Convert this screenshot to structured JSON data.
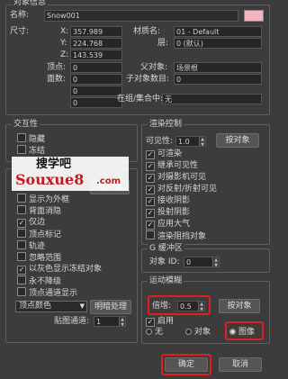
{
  "general": {
    "group_title": "对象信息",
    "name_label": "名称:",
    "name_value": "Snow001",
    "dims_label": "尺寸:",
    "x_label": "X:",
    "x_value": "357.989",
    "y_label": "Y:",
    "y_value": "224.768",
    "z_label": "Z:",
    "z_value": "143.539",
    "verts_label": "顶点:",
    "verts_value": "0",
    "faces_label": "面数:",
    "faces_value": "0",
    "f3_value": "0",
    "f4_value": "0",
    "material_label": "材质名:",
    "material_value": "01 - Default",
    "layer_label": "层:",
    "layer_value": "0 (默认)",
    "parent_label": "父对象:",
    "parent_value": "场景根",
    "children_label": "子对象数目:",
    "children_value": "0",
    "group_label": "在组/集合中:",
    "group_value": "无",
    "swatch_color": "#f2b6c0"
  },
  "interactivity": {
    "title": "交互性",
    "hide": "隐藏",
    "freeze": "冻结"
  },
  "display": {
    "by_object": "按对象",
    "display_as_box": "显示为外框",
    "backface_cull": "背面消隐",
    "edges_only": "仅边",
    "vertex_ticks": "顶点标记",
    "trajectory": "轨迹",
    "ignore_extents": "忽略范围",
    "show_frozen_gray": "以灰色显示冻结对象",
    "never_degrade": "永不降级",
    "vertex_channel_display": "顶点通道显示",
    "vertex_color_option": "顶点颜色",
    "shaded_button": "明暗处理",
    "map_channel_label": "贴图通道:",
    "map_channel_value": "1"
  },
  "watermark": {
    "cn": "搜学吧",
    "en": "Souxue8",
    "dom": ".com"
  },
  "render": {
    "title": "渲染控制",
    "visibility_label": "可见性:",
    "visibility_value": "1.0",
    "by_object": "按对象",
    "renderable": "可渲染",
    "inherit_visibility": "继承可见性",
    "visible_to_camera": "对摄影机可见",
    "visible_to_reflection": "对反射/折射可见",
    "receive_shadows": "接收阴影",
    "cast_shadows": "投射阴影",
    "apply_atmosphere": "应用大气",
    "render_occluded": "渲染阻挡对象"
  },
  "gbuffer": {
    "title": "G 缓冲区",
    "object_id_label": "对象 ID:",
    "object_id_value": "0"
  },
  "motion_blur": {
    "title": "运动模糊",
    "multiplier_label": "倍增:",
    "multiplier_value": "0.5",
    "by_object": "按对象",
    "enabled": "启用",
    "none": "无",
    "object": "对象",
    "image": "图像"
  },
  "footer": {
    "ok": "确定",
    "cancel": "取消"
  }
}
